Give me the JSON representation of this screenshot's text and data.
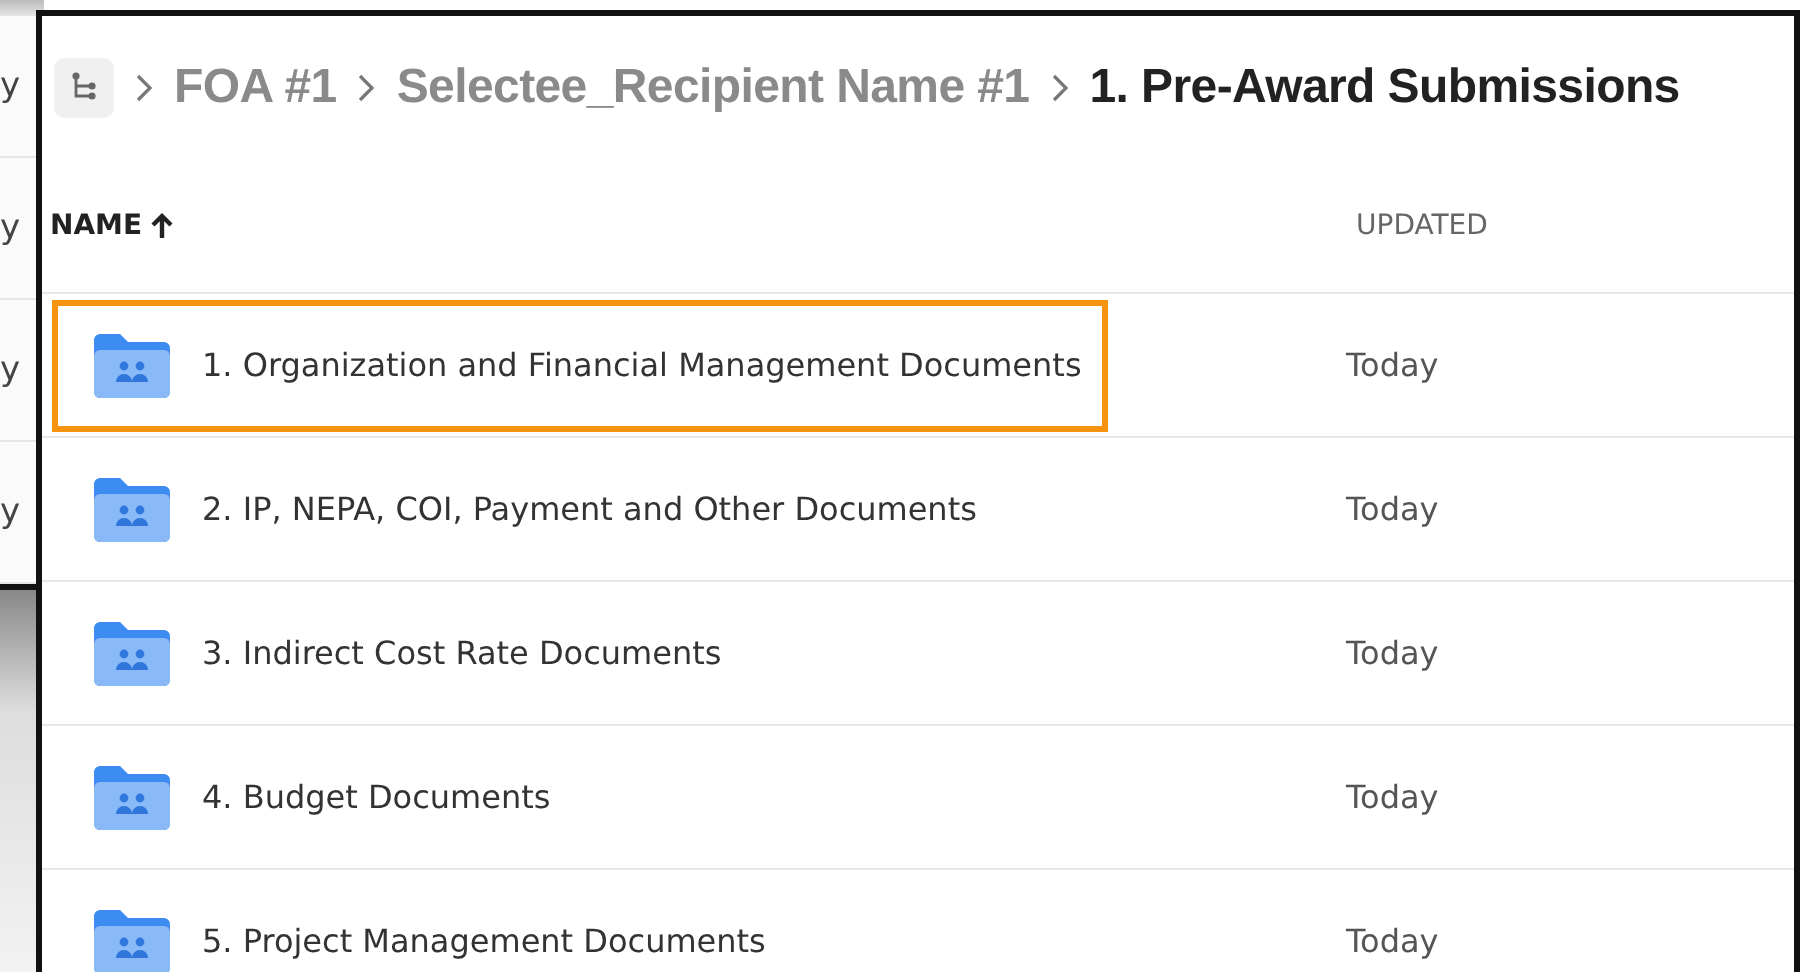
{
  "background_window": {
    "items": [
      "y",
      "y",
      "y",
      "y"
    ]
  },
  "breadcrumb": [
    {
      "label": "FOA #1",
      "current": false
    },
    {
      "label": "Selectee_Recipient Name #1",
      "current": false
    },
    {
      "label": "1. Pre-Award Submissions",
      "current": true
    }
  ],
  "table": {
    "columns": [
      {
        "label": "NAME",
        "sorted": true
      },
      {
        "label": "UPDATED",
        "sorted": false
      }
    ],
    "rows": [
      {
        "name": "1. Organization and Financial Management Documents",
        "updated": "Today",
        "highlighted": true
      },
      {
        "name": "2. IP, NEPA, COI, Payment and Other Documents",
        "updated": "Today",
        "highlighted": false
      },
      {
        "name": "3. Indirect Cost Rate Documents",
        "updated": "Today",
        "highlighted": false
      },
      {
        "name": "4. Budget Documents",
        "updated": "Today",
        "highlighted": false
      },
      {
        "name": "5. Project Management Documents",
        "updated": "Today",
        "highlighted": false
      }
    ]
  }
}
